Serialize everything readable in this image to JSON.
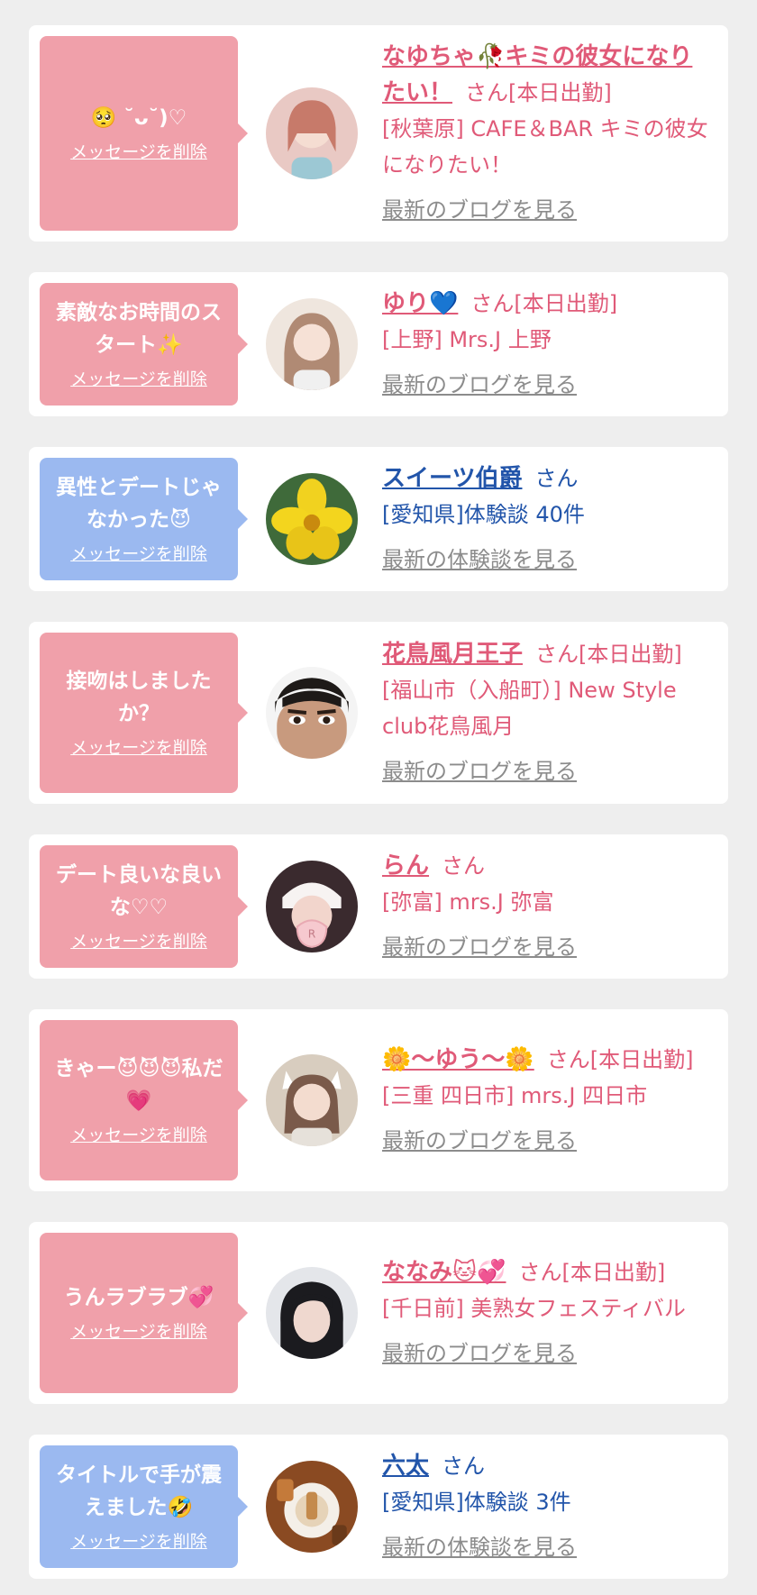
{
  "cards": [
    {
      "theme": "pink",
      "message": "🥺 ˘ᴗ˘)♡",
      "delete_label": "メッセージを削除",
      "name": "なゆちゃ🥀キミの彼女になりたい！",
      "suffix": "さん[本日出勤]",
      "shop": "[秋葉原] CAFE＆BAR キミの彼女になりたい！",
      "link": "最新のブログを見る",
      "avatar_icon": "profile-photo"
    },
    {
      "theme": "pink",
      "message": "素敵なお時間のスタート✨",
      "delete_label": "メッセージを削除",
      "name": "ゆり💙",
      "suffix": "さん[本日出勤]",
      "shop": "[上野] Mrs.J 上野",
      "link": "最新のブログを見る",
      "avatar_icon": "profile-photo"
    },
    {
      "theme": "blue",
      "message": "異性とデートじゃなかった😈",
      "delete_label": "メッセージを削除",
      "name": "スイーツ伯爵",
      "suffix": "さん",
      "shop": "[愛知県]体験談 40件",
      "link": "最新の体験談を見る",
      "avatar_icon": "flower-photo"
    },
    {
      "theme": "pink",
      "message": "接吻はしましたか？",
      "delete_label": "メッセージを削除",
      "name": "花鳥風月王子",
      "suffix": "さん[本日出勤]",
      "shop": "[福山市（入船町）] New Style club花鳥風月",
      "link": "最新のブログを見る",
      "avatar_icon": "profile-photo"
    },
    {
      "theme": "pink",
      "message": "デート良いな良いな♡♡",
      "delete_label": "メッセージを削除",
      "name": "らん",
      "suffix": "さん",
      "shop": "[弥富] mrs.J 弥富",
      "link": "最新のブログを見る",
      "avatar_icon": "profile-photo"
    },
    {
      "theme": "pink",
      "message": "きゃー😈😈😈私だ💗",
      "delete_label": "メッセージを削除",
      "name": "🌼〜ゆう〜🌼",
      "suffix": "さん[本日出勤]",
      "shop": "[三重 四日市] mrs.J 四日市",
      "link": "最新のブログを見る",
      "avatar_icon": "profile-photo"
    },
    {
      "theme": "pink",
      "message": "うんラブラブ💞",
      "delete_label": "メッセージを削除",
      "name": "ななみ🐱💞",
      "suffix": "さん[本日出勤]",
      "shop": "[千日前] 美熟女フェスティバル",
      "link": "最新のブログを見る",
      "avatar_icon": "profile-photo"
    },
    {
      "theme": "blue",
      "message": "タイトルで手が震えました🤣",
      "delete_label": "メッセージを削除",
      "name": "六太",
      "suffix": "さん",
      "shop": "[愛知県]体験談 3件",
      "link": "最新の体験談を見る",
      "avatar_icon": "food-photo"
    }
  ]
}
